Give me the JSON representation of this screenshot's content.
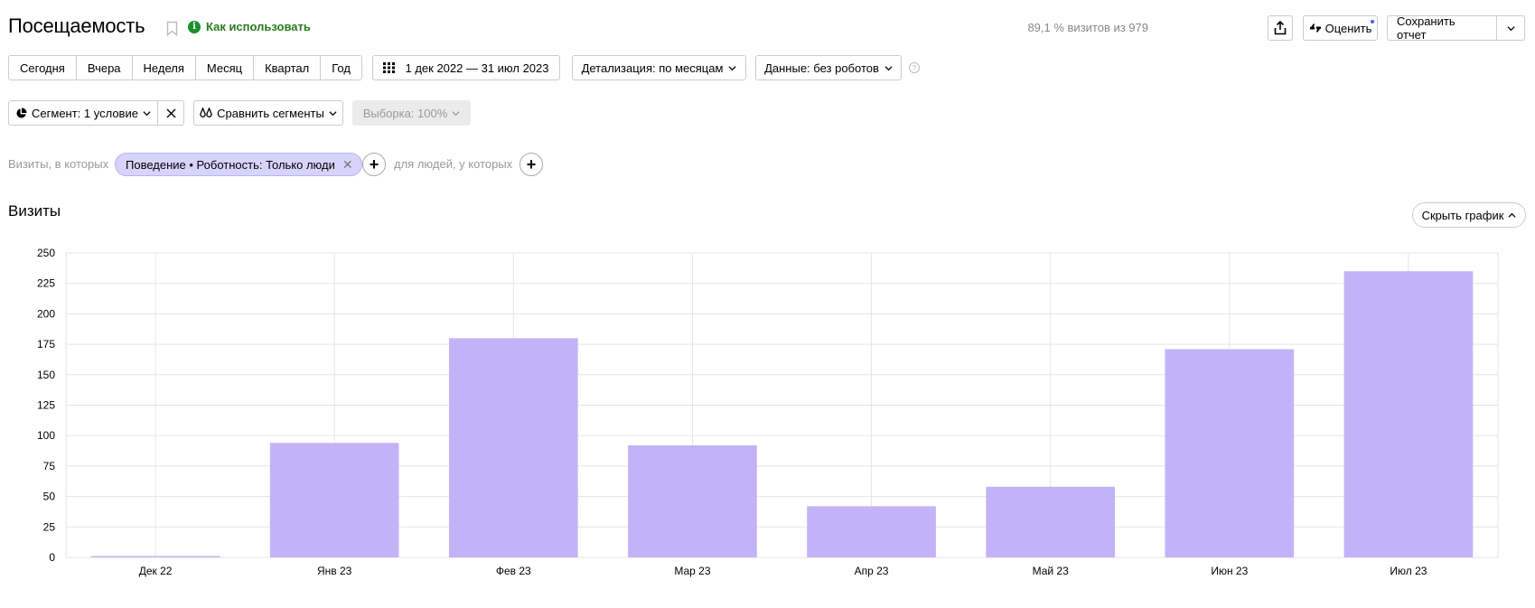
{
  "header": {
    "title": "Посещаемость",
    "howto_label": "Как использовать",
    "sample_info": "89,1 % визитов из 979",
    "rate_label": "Оценить",
    "save_label": "Сохранить отчет"
  },
  "period": {
    "options": [
      "Сегодня",
      "Вчера",
      "Неделя",
      "Месяц",
      "Квартал",
      "Год"
    ],
    "date_range": "1 дек 2022 — 31 июл 2023",
    "detail_label": "Детализация: по месяцам",
    "data_label": "Данные: без роботов"
  },
  "segment": {
    "segment_label": "Сегмент: 1 условие",
    "compare_label": "Сравнить сегменты",
    "sample_label": "Выборка: 100%"
  },
  "filter": {
    "prefix": "Визиты, в которых",
    "chip_label": "Поведение • Роботность: Только люди",
    "suffix": "для людей, у которых"
  },
  "chart_section": {
    "title": "Визиты",
    "hide_label": "Скрыть график"
  },
  "colors": {
    "bar": "#c2b3f8",
    "grid": "#e5e5e5",
    "accent_green": "#1a8f2f"
  },
  "chart_data": {
    "type": "bar",
    "categories": [
      "Дек 22",
      "Янв 23",
      "Фев 23",
      "Мар 23",
      "Апр 23",
      "Май 23",
      "Июн 23",
      "Июл 23"
    ],
    "values": [
      1,
      94,
      180,
      92,
      42,
      58,
      171,
      235
    ],
    "title": "",
    "xlabel": "",
    "ylabel": "",
    "ylim": [
      0,
      250
    ],
    "yticks": [
      0,
      25,
      50,
      75,
      100,
      125,
      150,
      175,
      200,
      225,
      250
    ],
    "grid": true
  }
}
